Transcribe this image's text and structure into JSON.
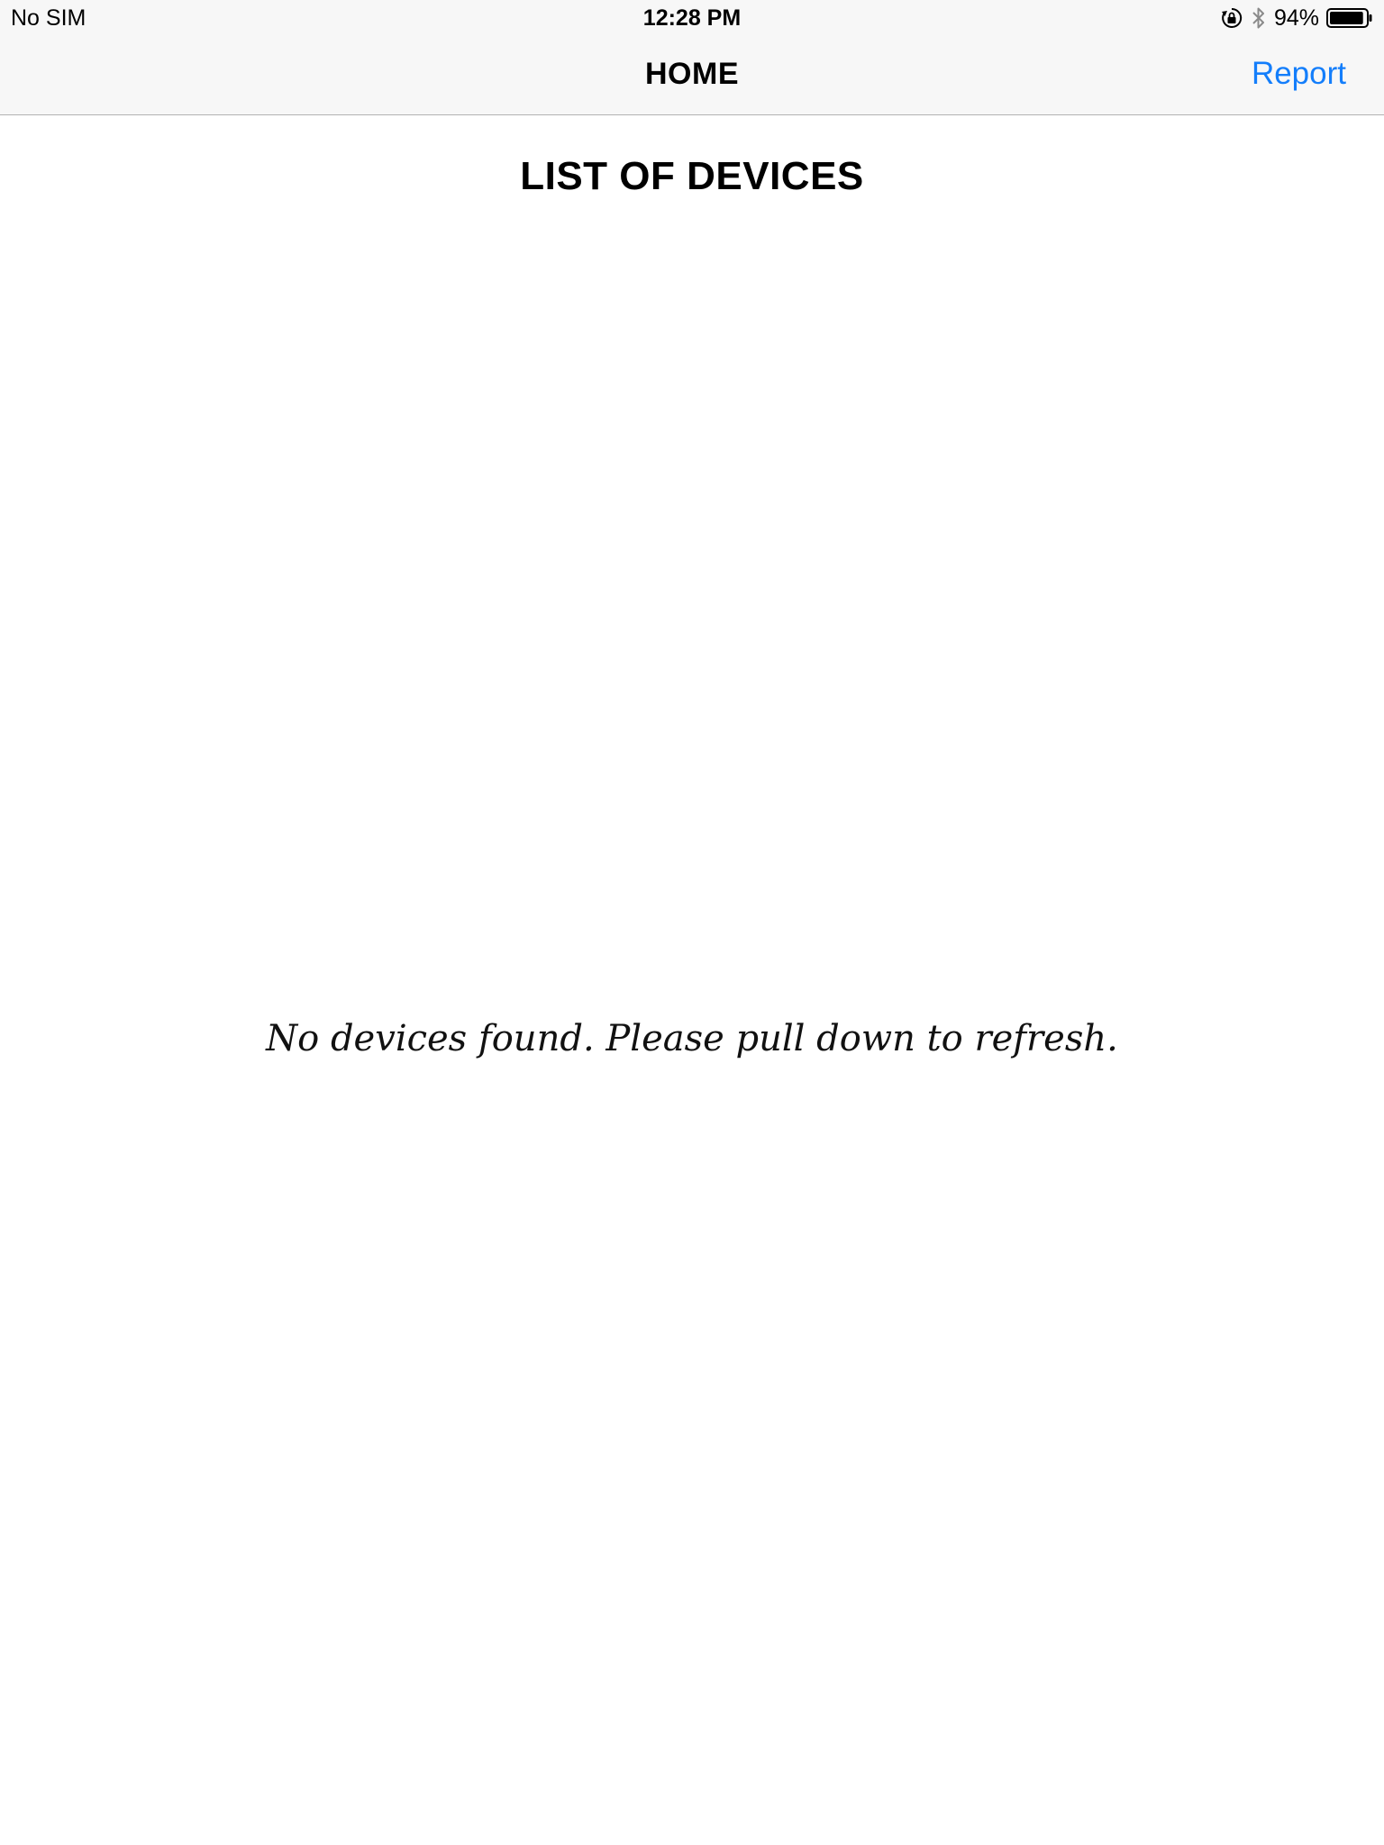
{
  "status_bar": {
    "carrier": "No SIM",
    "time": "12:28 PM",
    "battery_percent": "94%",
    "battery_level": 0.94,
    "icons": [
      "orientation-lock-icon",
      "bluetooth-icon",
      "battery-icon"
    ]
  },
  "nav": {
    "title": "HOME",
    "action_label": "Report",
    "accent_color": "#147efb"
  },
  "content": {
    "section_title": "LIST OF DEVICES",
    "empty_message": "No devices found. Please pull down to refresh."
  }
}
